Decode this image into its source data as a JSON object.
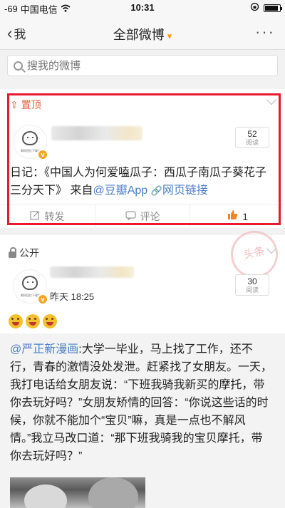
{
  "status_bar": {
    "signal": "-69",
    "carrier": "中国电信",
    "time": "10:31"
  },
  "nav": {
    "back_label": "我",
    "title": "全部微博",
    "title_arrow": "▾",
    "more": "···"
  },
  "search": {
    "placeholder": "搜我的微博"
  },
  "post1": {
    "pin_label": "置顶",
    "read_count": "52",
    "read_label": "阅读",
    "text_before": "日记：《中国人为何爱嗑瓜子：西瓜子南瓜子葵花子三分天下》 来自",
    "source_link": "@豆瓣App",
    "web_link": "网页链接",
    "actions": {
      "repost": "转发",
      "comment": "评论",
      "like_count": "1"
    },
    "avatar_caption": "瞬间回忆下载地"
  },
  "post2": {
    "visibility": "公开",
    "time": "昨天 18:25",
    "read_count": "30",
    "read_label": "阅读",
    "stamp": "头条",
    "repost": {
      "author": "@严正新漫画",
      "text": ":大学一毕业，马上找了工作，还不行，青春的激情没处发泄。赶紧找了女朋友。一天，我打电话给女朋友说：“下班我骑我新买的摩托，带你去玩好吗？”女朋友矫情的回答：“你说这些话的时候，你就不能加个“宝贝”嘛，真是一点也不解风情。”我立马改口道：“那下班我骑我的宝贝摩托，带你去玩好吗？”"
    }
  },
  "colors": {
    "highlight": "#e8192c",
    "link": "#4c7ec9",
    "accent": "#f29a00",
    "pin": "#e55a3a"
  }
}
